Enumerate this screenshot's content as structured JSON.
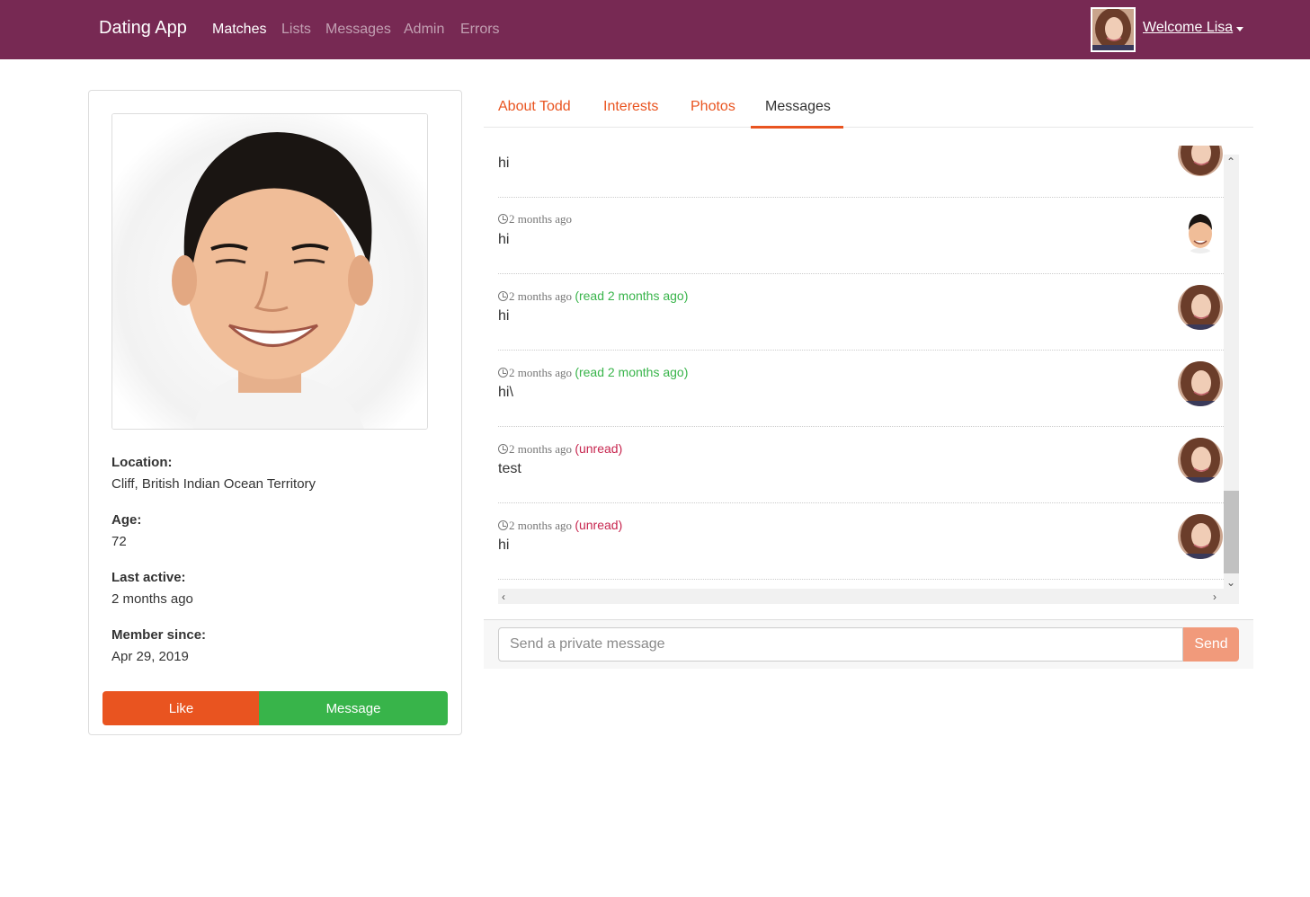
{
  "navbar": {
    "brand": "Dating App",
    "links": [
      "Matches",
      "Lists",
      "Messages",
      "Admin",
      "Errors"
    ],
    "active_link": "Matches",
    "welcome": "Welcome Lisa"
  },
  "profile": {
    "location_label": "Location:",
    "location": "Cliff, British Indian Ocean Territory",
    "age_label": "Age:",
    "age": "72",
    "last_active_label": "Last active:",
    "last_active": "2 months ago",
    "member_since_label": "Member since:",
    "member_since": "Apr 29, 2019",
    "like_label": "Like",
    "message_label": "Message"
  },
  "tabs": [
    "About Todd",
    "Interests",
    "Photos",
    "Messages"
  ],
  "active_tab": "Messages",
  "messages": [
    {
      "time": "",
      "status": "",
      "status_type": "",
      "text": "hi",
      "sender": "lisa"
    },
    {
      "time": "2 months ago",
      "status": "",
      "status_type": "",
      "text": "hi",
      "sender": "todd"
    },
    {
      "time": "2 months ago",
      "status": "(read 2 months ago)",
      "status_type": "read",
      "text": "hi",
      "sender": "lisa"
    },
    {
      "time": "2 months ago",
      "status": "(read 2 months ago)",
      "status_type": "read",
      "text": "hi\\",
      "sender": "lisa"
    },
    {
      "time": "2 months ago",
      "status": "(unread)",
      "status_type": "unread",
      "text": "test",
      "sender": "lisa"
    },
    {
      "time": "2 months ago",
      "status": "(unread)",
      "status_type": "unread",
      "text": "hi",
      "sender": "lisa"
    }
  ],
  "composer": {
    "placeholder": "Send a private message",
    "send_label": "Send"
  },
  "colors": {
    "navbar": "#772953",
    "primary": "#e95420",
    "success": "#38b44a",
    "unread": "#c7254e"
  }
}
